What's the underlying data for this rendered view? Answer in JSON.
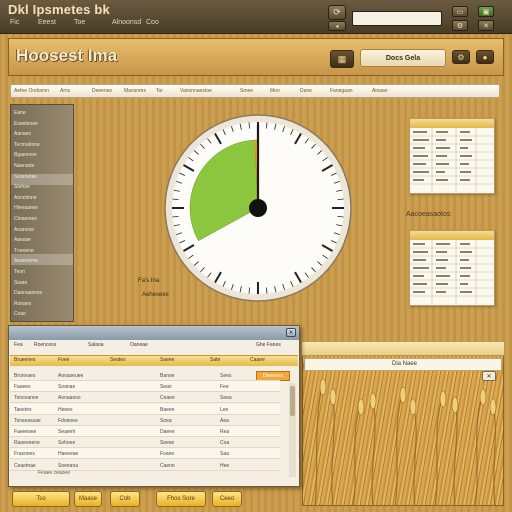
{
  "window": {
    "title": "Dkl Ipsmetes bk",
    "menu": [
      "Fic",
      "Eeest",
      "Toe",
      "Alnoonsd",
      "Coo"
    ],
    "search_value": "",
    "buttons": {
      "refresh": "⟳",
      "min": "▭",
      "max": "▣"
    }
  },
  "header": {
    "title": "Hoosest Ima",
    "chip_label": "Docs Gela",
    "icon": "grid-icon"
  },
  "toolbar": {
    "items": [
      "Aefee Ondoenn",
      "Arnc",
      "Deeenes",
      "Maosnres",
      "Tor",
      "Vanonnaestoe",
      "Smee",
      "Meo",
      "Dane",
      "Fanegaan",
      "Ainaan"
    ]
  },
  "sidebar": {
    "items": [
      "Eane",
      "Eseeteone",
      "Aanaes",
      "Tecmalrone",
      "Bgaeenee",
      "Naeraole",
      "Soarnetae",
      "Stehae",
      "Aonctmne",
      "Hleeaanes",
      "Ctoaemee",
      "Aoanooe",
      "Aaesae",
      "Tneoene",
      "Asaeeeme",
      "Teon",
      "Seare",
      "Daenaaones",
      "Ronaes",
      "Coao"
    ]
  },
  "gauge": {
    "value_fraction": 0.62,
    "caption_1": "Fa's Ina",
    "caption_2": "Aehesees"
  },
  "mini_panel": {
    "label": "Aacoeasaotos"
  },
  "dialog": {
    "tabs": [
      "Fea",
      "Roencess",
      "Salaoa",
      "Oaneae",
      "Ghe Fanes"
    ],
    "headers": [
      "Brueenes",
      "Foee",
      "Seates",
      "Saeee",
      "Sate",
      "Caaee"
    ],
    "badge": "Dneeees",
    "rows": [
      [
        "Bronnaes",
        "Aonaseuee",
        "Banoe",
        "Sees"
      ],
      [
        "Faaees",
        "Soanae",
        "Sean",
        "Fee"
      ],
      [
        "Tonceanne",
        "Aonaaeso",
        "Ceaee",
        "Seea"
      ],
      [
        "Taeetes",
        "Heees",
        "Baeee",
        "Lee"
      ],
      [
        "Tonseassae",
        "Fdoenee",
        "Soea",
        "Aea"
      ],
      [
        "Faeeesee",
        "Seaeeh",
        "Daeee",
        "Rea"
      ],
      [
        "Raoeeeene",
        "Sohoee",
        "Seese",
        "Coa"
      ],
      [
        "Frasones",
        "Haeeeae",
        "Foane",
        "Saa"
      ],
      [
        "Ceaetnae",
        "Soeeana",
        "Caene",
        "Hee"
      ]
    ],
    "status": "Feaee   ceaoee"
  },
  "wheat_panel": {
    "title": "Coneas Bras",
    "bar_label": "Dia Naee"
  },
  "bottom_buttons": [
    "Tso",
    "Maase",
    "Cob",
    "Fhos Sore",
    "Ceeo"
  ],
  "colors": {
    "accent": "#e8b224",
    "gauge_green": "#8cc63f",
    "gauge_orange": "#f5a623"
  }
}
